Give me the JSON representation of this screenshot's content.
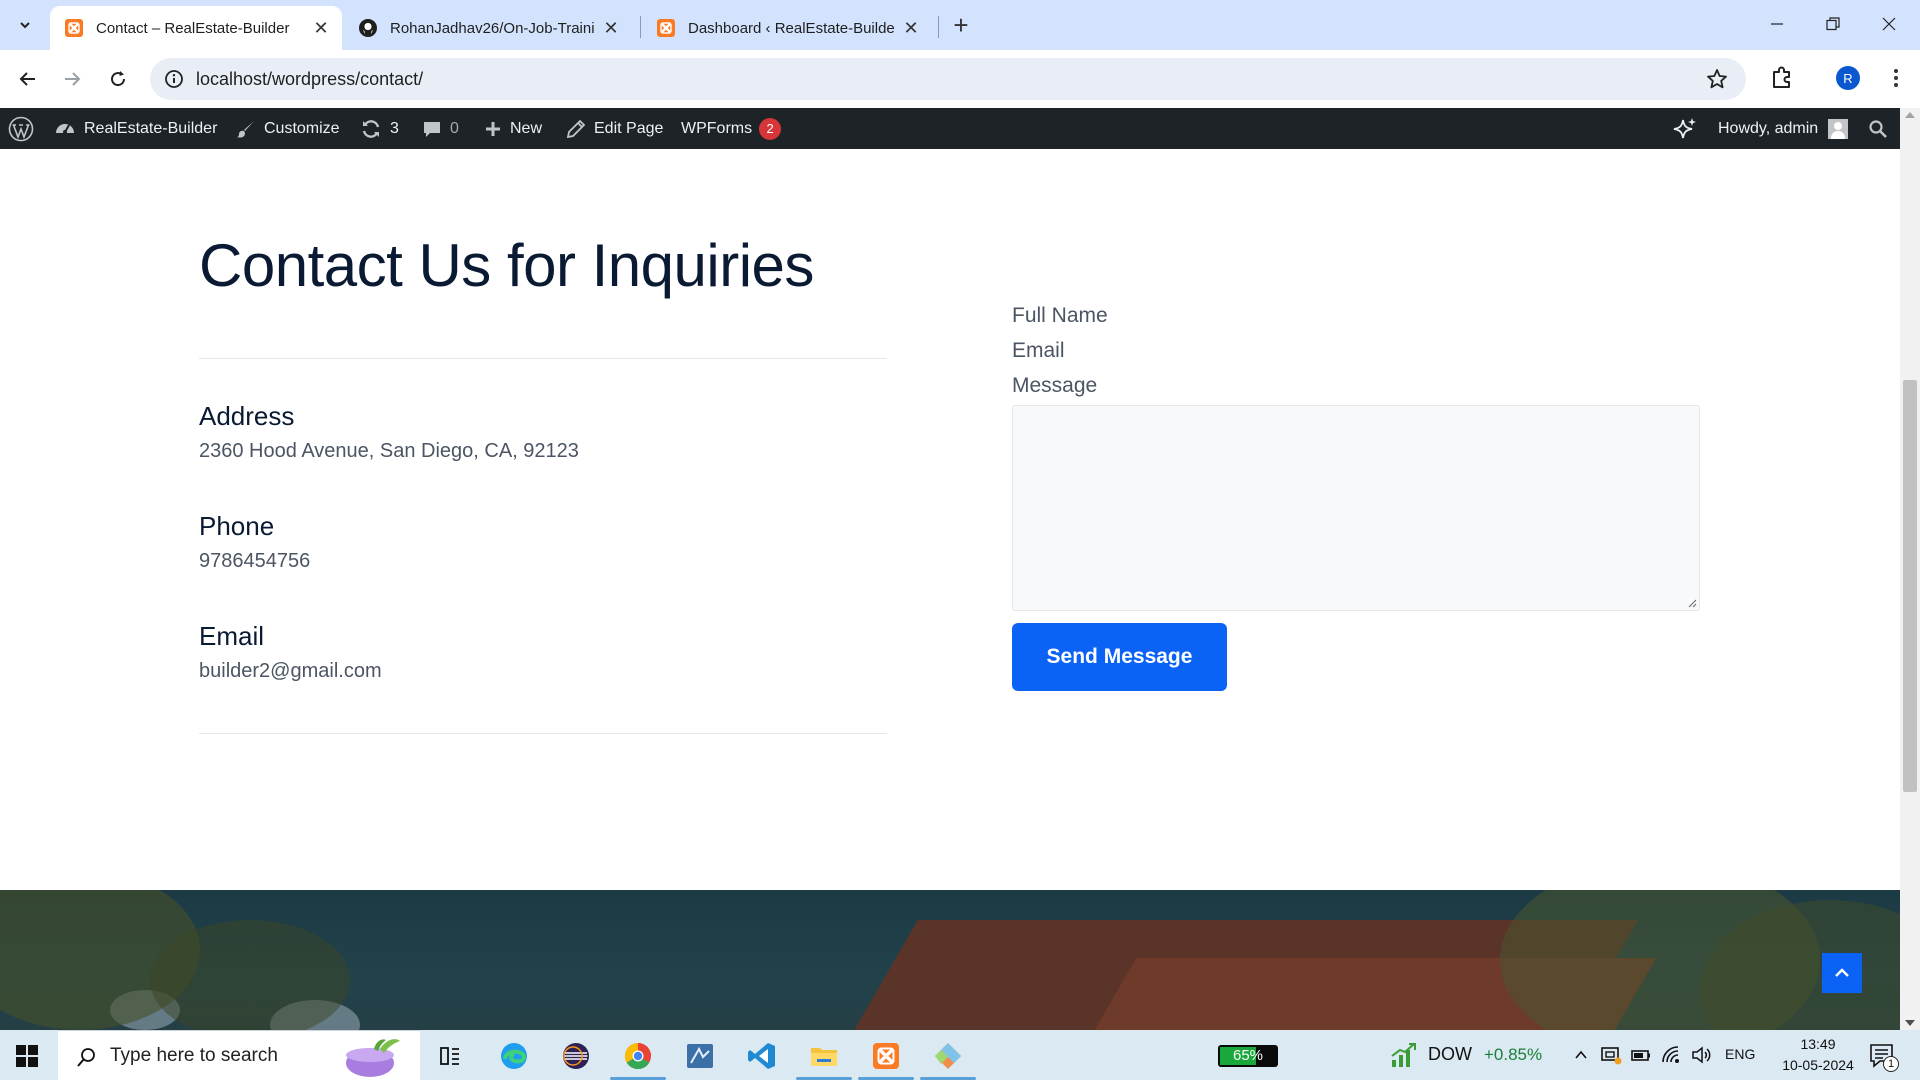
{
  "browser": {
    "tabs": [
      {
        "title": "Contact – RealEstate-Builder",
        "icon": "xampp-icon",
        "active": true
      },
      {
        "title": "RohanJadhav26/On-Job-Trainin",
        "icon": "github-icon",
        "active": false
      },
      {
        "title": "Dashboard ‹ RealEstate-Builder",
        "icon": "xampp-icon",
        "active": false
      }
    ],
    "url": "localhost/wordpress/contact/",
    "profile_initial": "R"
  },
  "admin_bar": {
    "site_name": "RealEstate-Builder",
    "customize": "Customize",
    "updates_count": "3",
    "comments_count": "0",
    "new_label": "New",
    "edit_page": "Edit Page",
    "wpforms": "WPForms",
    "wpforms_badge": "2",
    "greeting": "Howdy, admin"
  },
  "contact": {
    "title": "Contact Us for Inquiries",
    "address_heading": "Address",
    "address": "2360 Hood Avenue, San Diego, CA, 92123",
    "phone_heading": "Phone",
    "phone": "9786454756",
    "email_heading": "Email",
    "email": "builder2@gmail.com"
  },
  "form": {
    "full_name_label": "Full Name",
    "email_label": "Email",
    "message_label": "Message",
    "message_value": "",
    "submit_label": "Send Message"
  },
  "taskbar": {
    "search_placeholder": "Type here to search",
    "battery_percent": "65%",
    "battery_level": 0.65,
    "stock_name": "DOW",
    "stock_change": "+0.85%",
    "language": "ENG",
    "time": "13:49",
    "date": "10-05-2024",
    "notification_count": "1"
  },
  "colors": {
    "accent": "#0b63f6",
    "admin_bar": "#1d2327",
    "tab_strip": "#d3e3fd",
    "badge": "#d63638"
  }
}
